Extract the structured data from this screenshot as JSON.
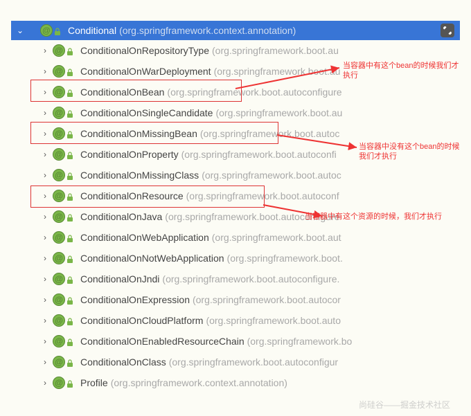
{
  "header": {
    "class_name": "Conditional",
    "package": "(org.springframework.context.annotation)"
  },
  "items": [
    {
      "class_name": "ConditionalOnRepositoryType",
      "package": "(org.springframework.boot.au"
    },
    {
      "class_name": "ConditionalOnWarDeployment",
      "package": "(org.springframework.boot.au"
    },
    {
      "class_name": "ConditionalOnBean",
      "package": "(org.springframework.boot.autoconfigure"
    },
    {
      "class_name": "ConditionalOnSingleCandidate",
      "package": "(org.springframework.boot.au"
    },
    {
      "class_name": "ConditionalOnMissingBean",
      "package": "(org.springframework.boot.autoc"
    },
    {
      "class_name": "ConditionalOnProperty",
      "package": "(org.springframework.boot.autoconfi"
    },
    {
      "class_name": "ConditionalOnMissingClass",
      "package": "(org.springframework.boot.autoc"
    },
    {
      "class_name": "ConditionalOnResource",
      "package": "(org.springframework.boot.autoconf"
    },
    {
      "class_name": "ConditionalOnJava",
      "package": "(org.springframework.boot.autoconfigure"
    },
    {
      "class_name": "ConditionalOnWebApplication",
      "package": "(org.springframework.boot.aut"
    },
    {
      "class_name": "ConditionalOnNotWebApplication",
      "package": "(org.springframework.boot."
    },
    {
      "class_name": "ConditionalOnJndi",
      "package": "(org.springframework.boot.autoconfigure."
    },
    {
      "class_name": "ConditionalOnExpression",
      "package": "(org.springframework.boot.autocor"
    },
    {
      "class_name": "ConditionalOnCloudPlatform",
      "package": "(org.springframework.boot.auto"
    },
    {
      "class_name": "ConditionalOnEnabledResourceChain",
      "package": "(org.springframework.bo"
    },
    {
      "class_name": "ConditionalOnClass",
      "package": "(org.springframework.boot.autoconfigur"
    },
    {
      "class_name": "Profile",
      "package": "(org.springframework.context.annotation)"
    }
  ],
  "annotations": {
    "a1": "当容器中有这个bean的时候我们才执行",
    "a2": "当容器中没有这个bean的时候我们才执行",
    "a3": "当容器中有这个资源的时候，我们才执行"
  },
  "watermark": "尚硅谷——掘金技术社区"
}
